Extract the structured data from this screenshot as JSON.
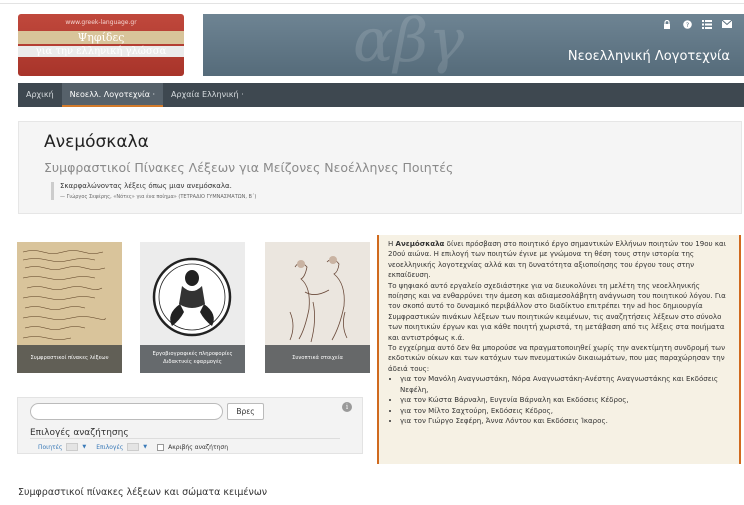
{
  "logo": {
    "url": "www.greek-language.gr",
    "line1": "Ψηφίδες",
    "line2": "για την ελληνική γλώσσα"
  },
  "banner": {
    "title": "Νεοελληνική Λογοτεχνία",
    "watermark": "αβγ",
    "icons": [
      "lock-icon",
      "help-icon",
      "list-icon",
      "mail-icon"
    ]
  },
  "nav": {
    "items": [
      {
        "label": "Αρχική"
      },
      {
        "label": "Νεοελλ. Λογοτεχνία ·"
      },
      {
        "label": "Αρχαία Ελληνική ·"
      }
    ]
  },
  "hero": {
    "title": "Ανεμόσκαλα",
    "subtitle": "Συμφραστικοί Πίνακες Λέξεων για Μείζονες Νεοέλληνες Ποιητές",
    "quote": "Σκαρφαλώνοντας λέξεις όπως μιαν ανεμόσκαλα.",
    "source": "— Γιώργος Σεφέρης, «Νότες» για ένα ποίημα» (ΤΕΤΡΑΔΙΟ ΓΥΜΝΑΣΜΑΤΩΝ, Β΄)"
  },
  "tiles": [
    {
      "caption": "Συμφραστικοί πίνακες λέξεων"
    },
    {
      "caption": "Εργοβιογραφικές πληροφορίες Διδακτικές εφαρμογές"
    },
    {
      "caption": "Συνοπτικά στοιχεία"
    }
  ],
  "search": {
    "placeholder": "",
    "button": "Βρες",
    "options_title": "Επιλογές αναζήτησης",
    "poets_label": "Ποιητές",
    "choices_label": "Επιλογές",
    "exact_label": "Ακριβής αναζήτηση"
  },
  "panel": {
    "intro_bold": "Ανεμόσκαλα",
    "intro": "Η Ανεμόσκαλα δίνει πρόσβαση στο ποιητικό έργο σημαντικών Ελλήνων ποιητών του 19ου και 20ού αιώνα. Η επιλογή των ποιητών έγινε με γνώμονα τη θέση τους στην ιστορία της νεοελληνικής λογοτεχνίας αλλά και τη δυνατότητα αξιοποίησης του έργου τους στην εκπαίδευση.",
    "p2": "Το ψηφιακό αυτό εργαλείο σχεδιάστηκε για να διευκολύνει τη μελέτη της νεοελληνικής ποίησης και να ενθαρρύνει την άμεση και αδιαμεσολάβητη ανάγνωση του ποιητικού λόγου. Για τον σκοπό αυτό το δυναμικό περιβάλλον στο διαδίκτυο επιτρέπει την ad hoc δημιουργία Συμφραστικών πινάκων λέξεων των ποιητικών κειμένων, τις αναζητήσεις λέξεων στο σύνολο των ποιητικών έργων και για κάθε ποιητή χωριστά, τη μετάβαση από τις λέξεις στα ποιήματα και αντιστρόφως κ.ά.",
    "p3": "Το εγχείρημα αυτό δεν θα μπορούσε να πραγματοποιηθεί χωρίς την ανεκτίμητη συνδρομή των εκδοτικών οίκων και των κατόχων των πνευματικών δικαιωμάτων, που μας παραχώρησαν την άδειά τους:",
    "list": [
      "για τον Μανόλη Αναγνωστάκη, Νόρα Αναγνωστάκη-Ανέστης Αναγνωστάκης και Εκδόσεις Νεφέλη,",
      "για τον Κώστα Βάρναλη, Ευγενία Βάρναλη και Εκδόσεις Κέδρος,",
      "για τον Μίλτο Σαχτούρη, Εκδόσεις Κέδρος,",
      "για τον Γιώργο Σεφέρη, Άννα Λόντου και Εκδόσεις Ίκαρος."
    ]
  },
  "bottom": {
    "title": "Συμφραστικοί πίνακες λέξεων και σώματα κειμένων"
  }
}
